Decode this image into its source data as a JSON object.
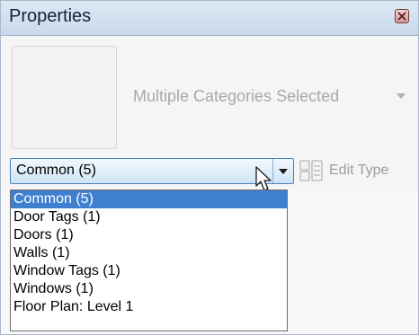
{
  "panel": {
    "title": "Properties"
  },
  "type_selector": {
    "name": "Multiple Categories Selected"
  },
  "filter": {
    "selected": "Common (5)",
    "edit_type_label": "Edit Type",
    "options": [
      "Common (5)",
      "Door Tags (1)",
      "Doors (1)",
      "Walls (1)",
      "Window Tags (1)",
      "Windows (1)",
      "Floor Plan: Level 1"
    ]
  },
  "colors": {
    "highlight": "#3f7fcf",
    "titlebar": "#c9d8ea"
  },
  "icons": [
    "close-icon",
    "chevron-down-icon",
    "cursor-arrow-icon",
    "edit-type-icon"
  ]
}
